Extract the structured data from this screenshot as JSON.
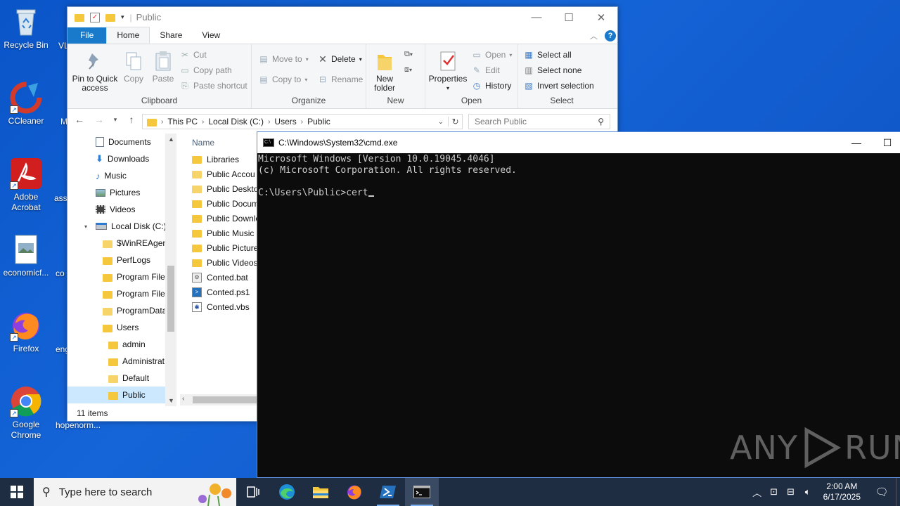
{
  "desktop": {
    "icons": [
      {
        "label": "Recycle Bin"
      },
      {
        "label": "CCleaner"
      },
      {
        "label": "Adobe Acrobat"
      },
      {
        "label": "economicf..."
      },
      {
        "label": "Firefox"
      },
      {
        "label": "Google Chrome"
      }
    ],
    "partial_labels": [
      "VL",
      "M",
      "ass",
      "co",
      "eng",
      "hopenorm..."
    ]
  },
  "explorer": {
    "title": "Public",
    "tabs": [
      "File",
      "Home",
      "Share",
      "View"
    ],
    "ribbon": {
      "clipboard": {
        "label": "Clipboard",
        "pin": "Pin to Quick access",
        "copy": "Copy",
        "paste": "Paste",
        "cut": "Cut",
        "copy_path": "Copy path",
        "paste_shortcut": "Paste shortcut"
      },
      "organize": {
        "label": "Organize",
        "move_to": "Move to",
        "copy_to": "Copy to",
        "delete": "Delete",
        "rename": "Rename"
      },
      "new": {
        "label": "New",
        "new_folder": "New folder"
      },
      "open": {
        "label": "Open",
        "properties": "Properties",
        "open": "Open",
        "edit": "Edit",
        "history": "History"
      },
      "select": {
        "label": "Select",
        "select_all": "Select all",
        "select_none": "Select none",
        "invert": "Invert selection"
      }
    },
    "breadcrumb": [
      "This PC",
      "Local Disk (C:)",
      "Users",
      "Public"
    ],
    "search_placeholder": "Search Public",
    "nav": [
      {
        "label": "Documents",
        "indent": 1,
        "icon": "doc"
      },
      {
        "label": "Downloads",
        "indent": 1,
        "icon": "down"
      },
      {
        "label": "Music",
        "indent": 1,
        "icon": "music"
      },
      {
        "label": "Pictures",
        "indent": 1,
        "icon": "pic"
      },
      {
        "label": "Videos",
        "indent": 1,
        "icon": "vid"
      },
      {
        "label": "Local Disk (C:)",
        "indent": 0,
        "icon": "disk"
      },
      {
        "label": "$WinREAgent",
        "indent": 2,
        "icon": "folder-light"
      },
      {
        "label": "PerfLogs",
        "indent": 2,
        "icon": "folder"
      },
      {
        "label": "Program Files",
        "indent": 2,
        "icon": "folder"
      },
      {
        "label": "Program Files",
        "indent": 2,
        "icon": "folder"
      },
      {
        "label": "ProgramData",
        "indent": 2,
        "icon": "folder-light"
      },
      {
        "label": "Users",
        "indent": 2,
        "icon": "folder"
      },
      {
        "label": "admin",
        "indent": 3,
        "icon": "folder"
      },
      {
        "label": "Administrat",
        "indent": 3,
        "icon": "folder"
      },
      {
        "label": "Default",
        "indent": 3,
        "icon": "folder-light"
      },
      {
        "label": "Public",
        "indent": 3,
        "icon": "folder",
        "selected": true
      }
    ],
    "column_name": "Name",
    "files": [
      {
        "label": "Libraries",
        "icon": "folder"
      },
      {
        "label": "Public Accou",
        "icon": "folder-light"
      },
      {
        "label": "Public Deskto",
        "icon": "folder-light"
      },
      {
        "label": "Public Docum",
        "icon": "folder"
      },
      {
        "label": "Public Downlo",
        "icon": "folder"
      },
      {
        "label": "Public Music",
        "icon": "folder"
      },
      {
        "label": "Public Picture",
        "icon": "folder"
      },
      {
        "label": "Public Videos",
        "icon": "folder"
      },
      {
        "label": "Conted.bat",
        "icon": "bat"
      },
      {
        "label": "Conted.ps1",
        "icon": "ps1"
      },
      {
        "label": "Conted.vbs",
        "icon": "vbs"
      }
    ],
    "status": "11 items"
  },
  "cmd": {
    "title": "C:\\Windows\\System32\\cmd.exe",
    "lines": [
      "Microsoft Windows [Version 10.0.19045.4046]",
      "(c) Microsoft Corporation. All rights reserved.",
      "",
      "C:\\Users\\Public>cert"
    ]
  },
  "watermark": {
    "left": "ANY",
    "right": "RUN"
  },
  "taskbar": {
    "search_placeholder": "Type here to search",
    "time": "2:00 AM",
    "date": "6/17/2025"
  },
  "colors": {
    "accent": "#1979ca",
    "desktop": "#1565d8",
    "taskbar": "#1f2d43",
    "folder": "#f4c73c"
  }
}
